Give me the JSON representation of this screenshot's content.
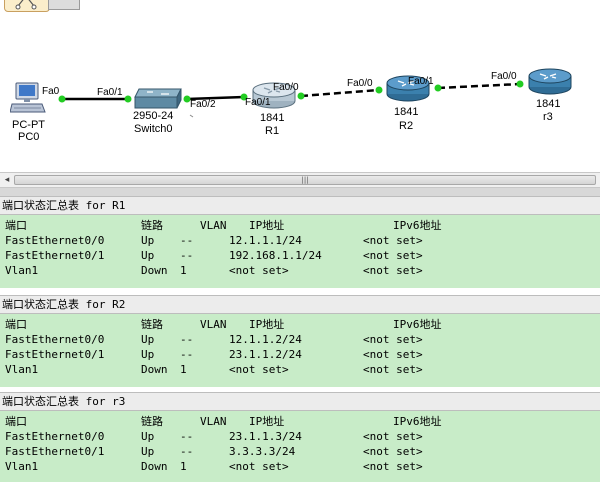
{
  "topology": {
    "devices": [
      {
        "model": "PC-PT",
        "name": "PC0",
        "icon": "pc-icon"
      },
      {
        "model": "2950-24",
        "name": "Switch0",
        "icon": "switch-icon"
      },
      {
        "model": "1841",
        "name": "R1",
        "icon": "router-icon"
      },
      {
        "model": "1841",
        "name": "R2",
        "icon": "router-icon"
      },
      {
        "model": "1841",
        "name": "r3",
        "icon": "router-icon"
      }
    ],
    "ports": {
      "pc0_fa0": "Fa0",
      "sw_fa0_1": "Fa0/1",
      "sw_fa0_2": "Fa0/2",
      "r1_fa0_1": "Fa0/1",
      "r1_fa0_0": "Fa0/0",
      "r2_fa0_0": "Fa0/0",
      "r2_fa0_1": "Fa0/1",
      "r3_fa0_0": "Fa0/0"
    },
    "link_status_color": "#22cc22"
  },
  "colors": {
    "panel_bg": "#c8ecc8",
    "title_bg": "#ececec"
  },
  "panels": [
    {
      "title": "端口状态汇总表 for R1",
      "headers": [
        "端口",
        "链路",
        "VLAN",
        "IP地址",
        "IPv6地址"
      ],
      "rows": [
        [
          "FastEthernet0/0",
          "Up",
          "--",
          "12.1.1.1/24",
          "<not set>"
        ],
        [
          "FastEthernet0/1",
          "Up",
          "--",
          "192.168.1.1/24",
          "<not set>"
        ],
        [
          "Vlan1",
          "Down",
          "1",
          "<not set>",
          "<not set>"
        ]
      ]
    },
    {
      "title": "端口状态汇总表 for R2",
      "headers": [
        "端口",
        "链路",
        "VLAN",
        "IP地址",
        "IPv6地址"
      ],
      "rows": [
        [
          "FastEthernet0/0",
          "Up",
          "--",
          "12.1.1.2/24",
          "<not set>"
        ],
        [
          "FastEthernet0/1",
          "Up",
          "--",
          "23.1.1.2/24",
          "<not set>"
        ],
        [
          "Vlan1",
          "Down",
          "1",
          "<not set>",
          "<not set>"
        ]
      ]
    },
    {
      "title": "端口状态汇总表 for r3",
      "headers": [
        "端口",
        "链路",
        "VLAN",
        "IP地址",
        "IPv6地址"
      ],
      "rows": [
        [
          "FastEthernet0/0",
          "Up",
          "--",
          "23.1.1.3/24",
          "<not set>"
        ],
        [
          "FastEthernet0/1",
          "Up",
          "--",
          "3.3.3.3/24",
          "<not set>"
        ],
        [
          "Vlan1",
          "Down",
          "1",
          "<not set>",
          "<not set>"
        ]
      ]
    }
  ],
  "scrollbar": {
    "left_icon": "arrow-left-icon",
    "grip": "|||"
  }
}
